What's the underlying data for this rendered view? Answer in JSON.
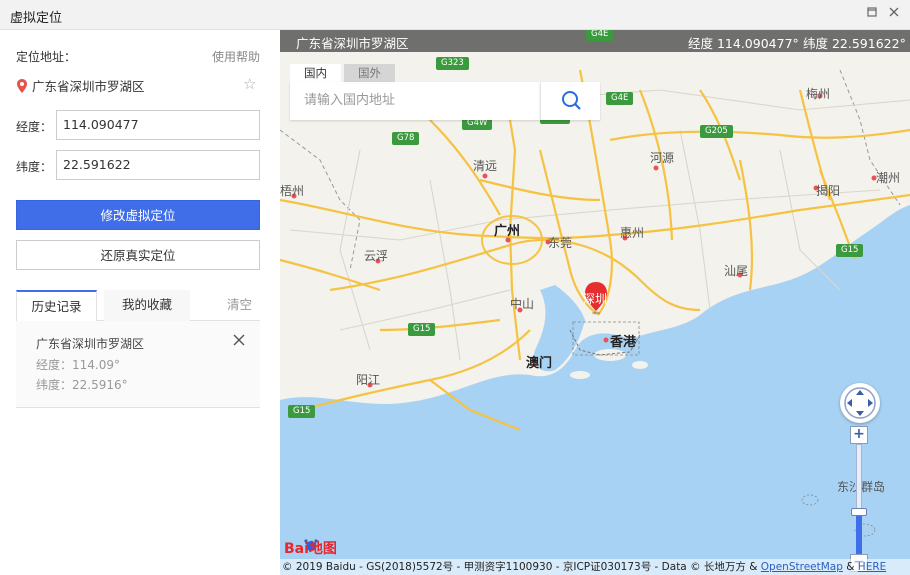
{
  "window": {
    "title": "虚拟定位",
    "maximize_icon": "maximize-icon",
    "close_icon": "close-icon"
  },
  "panel": {
    "location_label": "定位地址：",
    "help_link": "使用帮助",
    "address": "广东省深圳市罗湖区",
    "longitude_label": "经度：",
    "longitude_value": "114.090477",
    "latitude_label": "纬度：",
    "latitude_value": "22.591622",
    "modify_button": "修改虚拟定位",
    "restore_button": "还原真实定位",
    "tabs": {
      "history": "历史记录",
      "favorites": "我的收藏",
      "clear": "清空"
    },
    "history": [
      {
        "address": "广东省深圳市罗湖区",
        "longitude": "经度：114.09°",
        "latitude": "纬度：22.5916°"
      }
    ]
  },
  "map": {
    "top_address": "广东省深圳市罗湖区",
    "top_longitude": "经度 114.090477°",
    "top_latitude": "纬度 22.591622°",
    "search_tab_domestic": "国内",
    "search_tab_foreign": "国外",
    "search_placeholder": "请输入国内地址",
    "cities": {
      "meizhou": "梅州",
      "heyuan": "河源",
      "qingyuan": "清远",
      "jieyang": "揭阳",
      "chaozhou": "潮州",
      "wuzhou": "梧州",
      "guangzhou": "广州",
      "dongguan": "东莞",
      "huizhou": "惠州",
      "yunfu": "云浮",
      "shanwei": "汕尾",
      "zhongshan": "中山",
      "shenzhen": "深圳",
      "hongkong": "香港",
      "macau": "澳门",
      "yangjiang": "阳江",
      "dongsha": "东沙群岛"
    },
    "roads": {
      "g4e_top": "G4E",
      "g323": "G323",
      "g4e": "G4E",
      "g78": "G78",
      "g205": "G205",
      "g15_right": "G15",
      "g15_mid": "G15",
      "g15_left": "G15",
      "g4w": "G4W"
    },
    "logo": "Bai地图",
    "copyright_text": "© 2019 Baidu - GS(2018)5572号 - 甲测资字1100930 - 京ICP证030173号 - Data © 长地万方 &",
    "copyright_osm": "OpenStreetMap",
    "copyright_and": "&",
    "copyright_here": "HERE",
    "zoom_in": "+",
    "zoom_out": "−"
  },
  "colors": {
    "accent": "#3f6ee8",
    "water": "#a8d2f3",
    "land": "#f4f2ec",
    "highway": "#f5c242",
    "marker": "#e62e2e"
  }
}
